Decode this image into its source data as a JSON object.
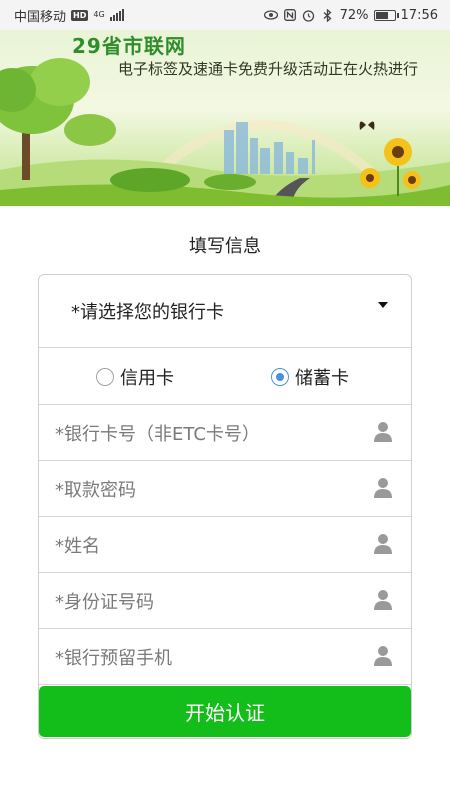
{
  "status_bar": {
    "carrier": "中国移动",
    "hd": "HD",
    "network": "4G",
    "battery_percent": "72%",
    "battery_level": 0.72,
    "time": "17:56",
    "icons": [
      "eye-icon",
      "nfc-icon",
      "alarm-icon",
      "bluetooth-icon"
    ]
  },
  "banner": {
    "title": "29省市联网",
    "subtitle": "电子标签及速通卡免费升级活动正在火热进行"
  },
  "form": {
    "title": "填写信息",
    "bank_select": "*请选择您的银行卡",
    "card_types": [
      {
        "label": "信用卡",
        "checked": false
      },
      {
        "label": "储蓄卡",
        "checked": true
      }
    ],
    "fields": [
      {
        "placeholder": "*银行卡号（非ETC卡号）"
      },
      {
        "placeholder": "*取款密码"
      },
      {
        "placeholder": "*姓名"
      },
      {
        "placeholder": "*身份证号码"
      },
      {
        "placeholder": "*银行预留手机"
      }
    ],
    "submit_label": "开始认证"
  },
  "colors": {
    "primary_green": "#13bd1a",
    "radio_blue": "#4a90e2"
  }
}
